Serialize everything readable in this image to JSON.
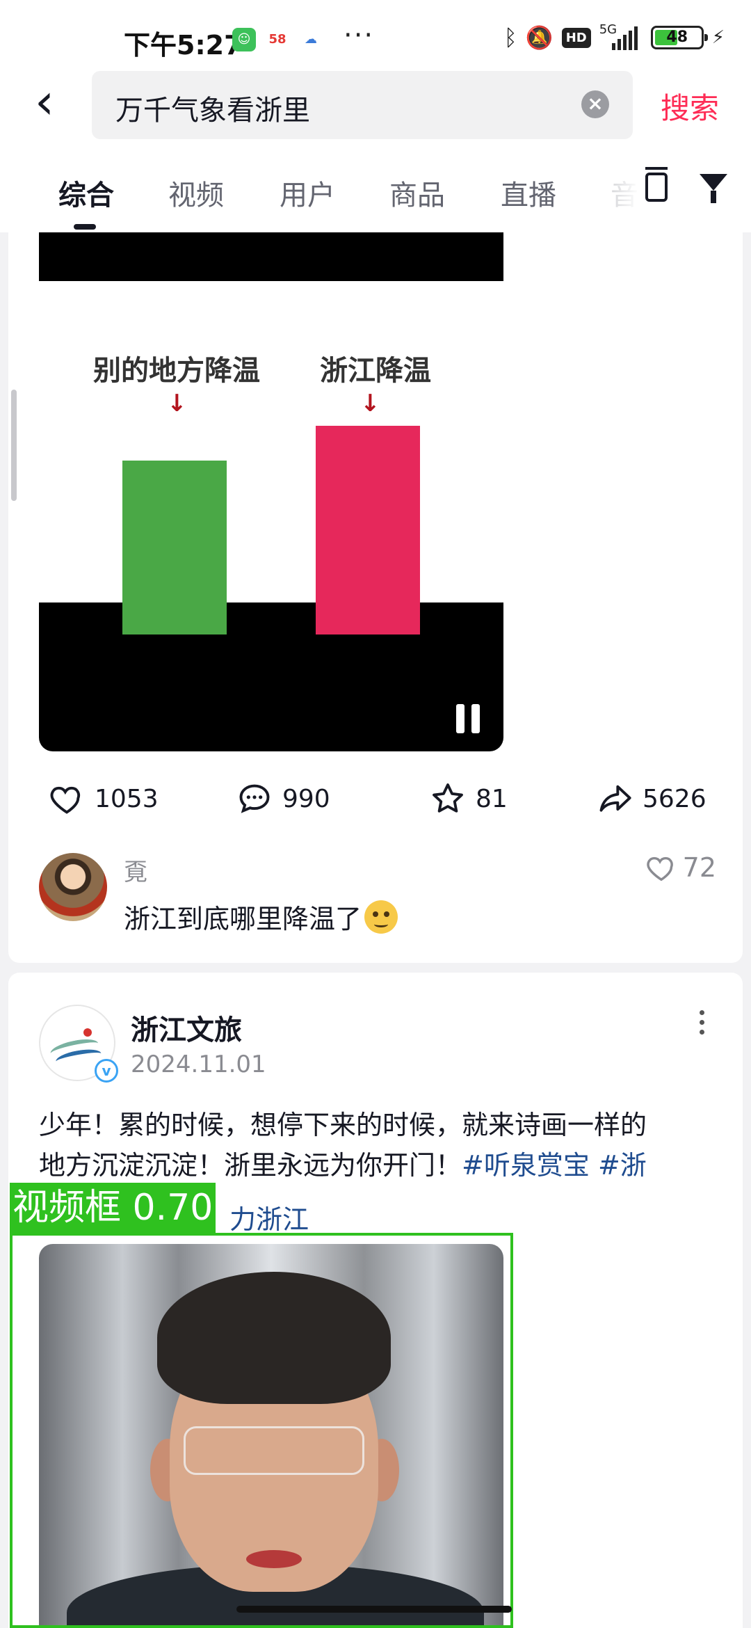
{
  "status_bar": {
    "time": "下午5:27",
    "battery": "48",
    "network": "5G",
    "hd": "HD"
  },
  "search": {
    "query": "万千气象看浙里",
    "button": "搜索"
  },
  "tabs": [
    "综合",
    "视频",
    "用户",
    "商品",
    "直播",
    "音"
  ],
  "video1": {
    "label_left": "别的地方降温",
    "label_right": "浙江降温",
    "arrow": "↓"
  },
  "stats": {
    "likes": "1053",
    "comments": "990",
    "favorites": "81",
    "shares": "5626"
  },
  "top_comment": {
    "user": "覔",
    "text": "浙江到底哪里降温了",
    "likes": "72"
  },
  "post": {
    "author": "浙江文旅",
    "date": "2024.11.01",
    "text_line1": "少年！累的时候，想停下来的时候，就来诗画一样的",
    "text_line2": "地方沉淀沉淀！浙里永远为你开门！",
    "hashtag1": "#听泉赏宝",
    "hashtag2": "#浙",
    "text_line3_tail": "力浙江",
    "verified": "v"
  },
  "detection": {
    "label": "视频框 0.70"
  },
  "colors": {
    "accent": "#fe2c55",
    "hashtag": "#1f4c8f",
    "detection": "#2fc11f",
    "bar_green": "#4aa846",
    "bar_red": "#e6285b"
  }
}
